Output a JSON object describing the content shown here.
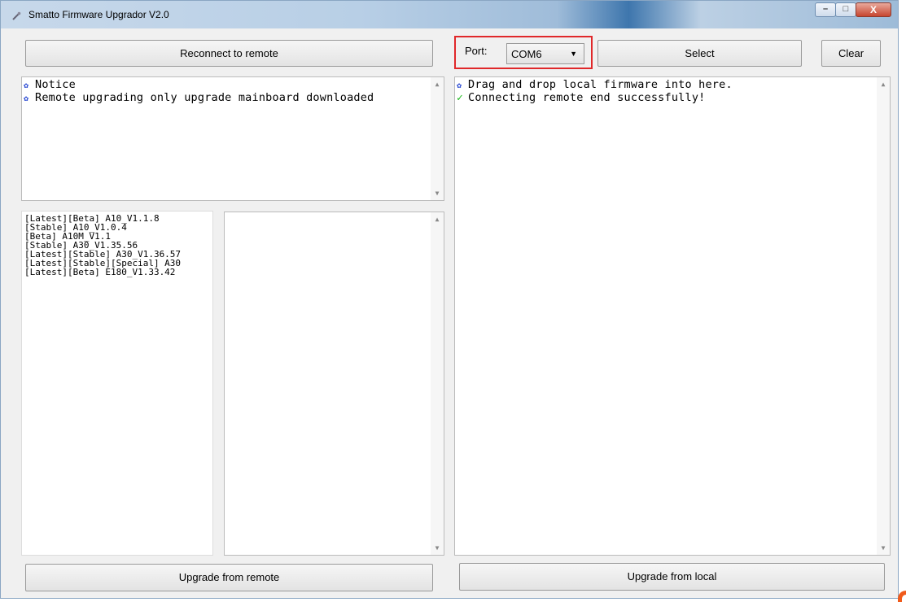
{
  "window": {
    "title": "Smatto Firmware Upgrador V2.0"
  },
  "caption": {
    "minimize": "–",
    "maximize": "□",
    "close": "X"
  },
  "toolbar": {
    "reconnect_label": "Reconnect to remote",
    "port_label": "Port:",
    "port_value": "COM6",
    "select_label": "Select",
    "clear_label": "Clear"
  },
  "notice_log": {
    "lines": [
      "Notice",
      "Remote upgrading only upgrade mainboard downloaded"
    ]
  },
  "firmware_list": {
    "items": [
      "[Latest][Beta] A10_V1.1.8",
      "[Stable] A10_V1.0.4",
      "[Beta] A10M_V1.1",
      "[Stable] A30_V1.35.56",
      "[Latest][Stable] A30_V1.36.57",
      "[Latest][Stable][Special] A30",
      "[Latest][Beta] E180_V1.33.42"
    ]
  },
  "local_log": {
    "lines": [
      {
        "icon": "bullet",
        "text": "Drag and drop local firmware into here."
      },
      {
        "icon": "check",
        "text": "Connecting remote end successfully!"
      }
    ]
  },
  "footer": {
    "upgrade_remote_label": "Upgrade from remote",
    "upgrade_local_label": "Upgrade from local"
  },
  "colors": {
    "accent_highlight": "#e0282a",
    "success": "#18b818",
    "bullet": "#1a3ccf"
  }
}
